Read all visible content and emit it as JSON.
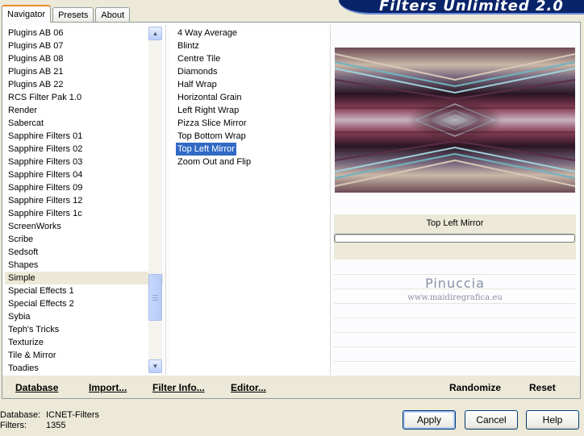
{
  "app": {
    "title": "Filters Unlimited 2.0"
  },
  "tabs": [
    {
      "label": "Navigator",
      "active": true
    },
    {
      "label": "Presets",
      "active": false
    },
    {
      "label": "About",
      "active": false
    }
  ],
  "categories": {
    "items": [
      "Plugins AB 06",
      "Plugins AB 07",
      "Plugins AB 08",
      "Plugins AB 21",
      "Plugins AB 22",
      "RCS Filter Pak 1.0",
      "Render",
      "Sabercat",
      "Sapphire Filters 01",
      "Sapphire Filters 02",
      "Sapphire Filters 03",
      "Sapphire Filters 04",
      "Sapphire Filters 09",
      "Sapphire Filters 12",
      "Sapphire Filters 1c",
      "ScreenWorks",
      "Scribe",
      "Sedsoft",
      "Shapes",
      "Simple",
      "Special Effects 1",
      "Special Effects 2",
      "Sybia",
      "Teph's Tricks",
      "Texturize",
      "Tile & Mirror",
      "Toadies"
    ],
    "selected": "Simple"
  },
  "filters": {
    "items": [
      "4 Way Average",
      "Blintz",
      "Centre Tile",
      "Diamonds",
      "Half Wrap",
      "Horizontal Grain",
      "Left Right Wrap",
      "Pizza Slice Mirror",
      "Top Bottom Wrap",
      "Top Left Mirror",
      "Zoom Out and Flip"
    ],
    "selected": "Top Left Mirror"
  },
  "preview": {
    "filter_name": "Top Left Mirror",
    "watermark_name": "Pinuccia",
    "watermark_url": "www.maidiregrafica.eu"
  },
  "toolbar": {
    "database_label": "Database",
    "import_label": "Import...",
    "filter_info_label": "Filter Info...",
    "editor_label": "Editor...",
    "randomize_label": "Randomize",
    "reset_label": "Reset"
  },
  "info": {
    "database_key": "Database:",
    "database_value": "ICNET-Filters",
    "filters_key": "Filters:",
    "filters_value": "1355"
  },
  "buttons": {
    "apply": "Apply",
    "cancel": "Cancel",
    "help": "Help"
  },
  "colors": {
    "selection": "#316ac5",
    "banner": "#0a246a",
    "dialog_bg": "#ece9d8"
  }
}
